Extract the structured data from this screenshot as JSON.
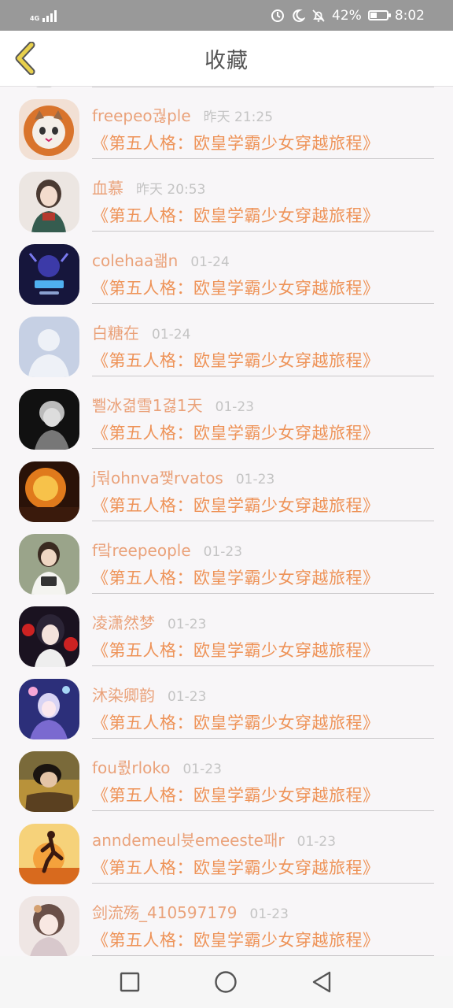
{
  "status_bar": {
    "network": "4G",
    "battery_percent": "42%",
    "battery_level": 0.42,
    "time": "8:02",
    "icons": [
      "data-saver-icon",
      "moon-icon",
      "bell-off-icon",
      "battery-icon"
    ]
  },
  "header": {
    "title": "收藏",
    "back_icon": "chevron-left-icon",
    "accent_color": "#e8d04c"
  },
  "colors": {
    "username": "#eaa27a",
    "title": "#ee9358",
    "timestamp": "#c4c4c4"
  },
  "favorites": [
    {
      "username": "freepeo궎ple",
      "time": "昨天 21:25",
      "title": "《第五人格：欧皇学霸少女穿越旅程》",
      "avatar": "cat-avatar"
    },
    {
      "username": "血慕",
      "time": "昨天 20:53",
      "title": "《第五人格：欧皇学霸少女穿越旅程》",
      "avatar": "girl-illustration-avatar"
    },
    {
      "username": "colehaa괢n",
      "time": "01-24",
      "title": "《第五人格：欧皇学霸少女穿越旅程》",
      "avatar": "crab-logo-avatar"
    },
    {
      "username": "白糖在",
      "time": "01-24",
      "title": "《第五人格：欧皇学霸少女穿越旅程》",
      "avatar": "default-person-avatar"
    },
    {
      "username": "뾀冰겲雪1겷1天",
      "time": "01-23",
      "title": "《第五人格：欧皇学霸少女穿越旅程》",
      "avatar": "bw-photo-avatar"
    },
    {
      "username": "j둮ohnva쨏rvatos",
      "time": "01-23",
      "title": "《第五人格：欧皇学霸少女穿越旅程》",
      "avatar": "fire-avatar"
    },
    {
      "username": "f랔reepeople",
      "time": "01-23",
      "title": "《第五人格：欧皇学霸少女穿越旅程》",
      "avatar": "camera-girl-avatar"
    },
    {
      "username": "凌潇然梦",
      "time": "01-23",
      "title": "《第五人格：欧皇学霸少女穿越旅程》",
      "avatar": "anime-girl-roses-avatar"
    },
    {
      "username": "沐染卿韵",
      "time": "01-23",
      "title": "《第五人格：欧皇学霸少女穿越旅程》",
      "avatar": "anime-fireworks-avatar"
    },
    {
      "username": "fou뤐rloko",
      "time": "01-23",
      "title": "《第五人格：欧皇学霸少女穿越旅程》",
      "avatar": "lying-person-avatar"
    },
    {
      "username": "anndemeul븃emeeste패r",
      "time": "01-23",
      "title": "《第五人格：欧皇学霸少女穿越旅程》",
      "avatar": "sunset-runner-avatar"
    },
    {
      "username": "剑流殇_410597179",
      "time": "01-23",
      "title": "《第五人格：欧皇学霸少女穿越旅程》",
      "avatar": "anime-doll-avatar"
    }
  ],
  "nav_bar": {
    "buttons": [
      "recent-apps-icon",
      "home-icon",
      "back-triangle-icon"
    ]
  }
}
